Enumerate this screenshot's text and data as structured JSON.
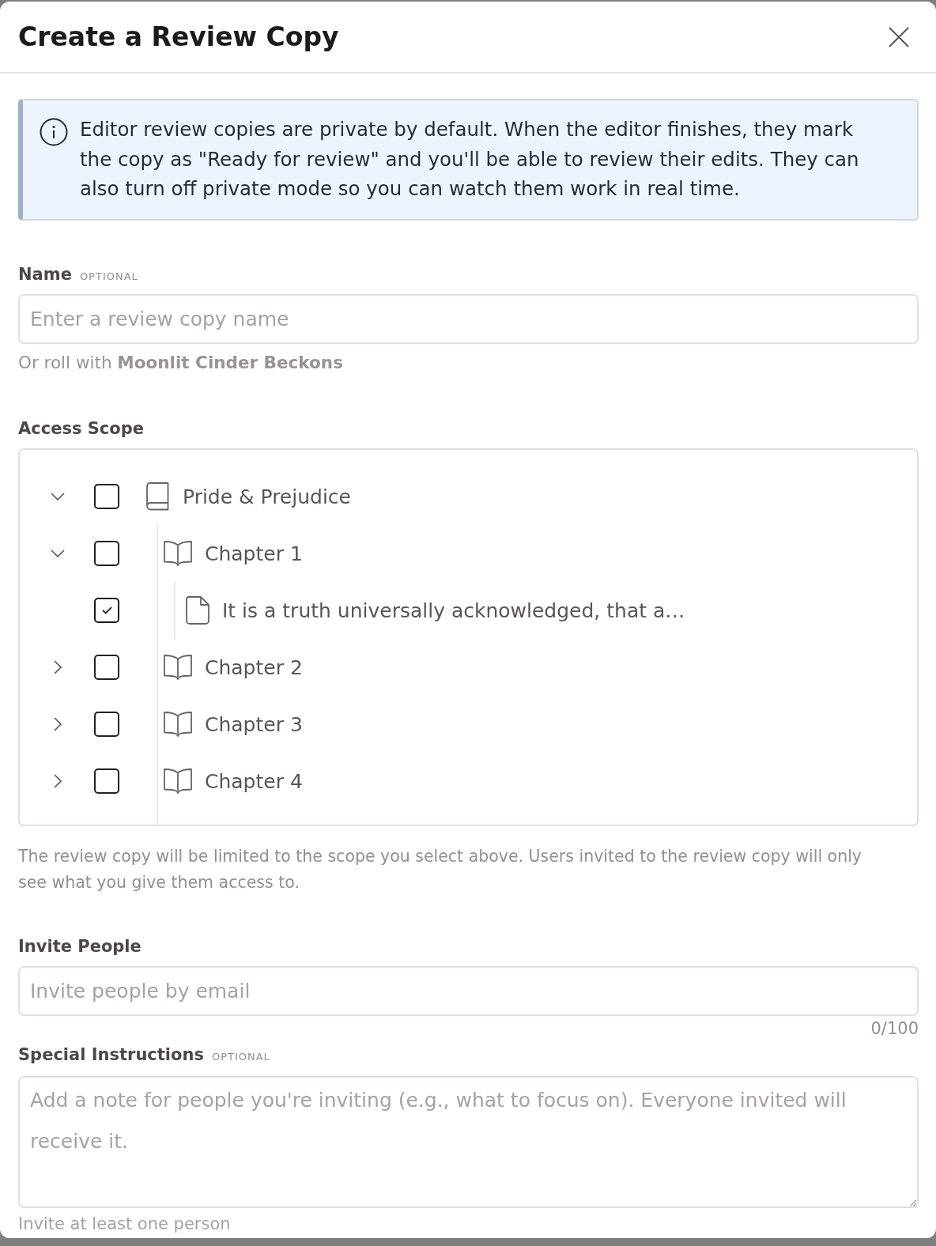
{
  "dialog": {
    "title": "Create a Review Copy"
  },
  "info_banner": {
    "text": "Editor review copies are private by default. When the editor finishes, they mark the copy as \"Ready for review\" and you'll be able to review their edits. They can also turn off private mode so you can watch them work in real time."
  },
  "name_field": {
    "label": "Name",
    "tag": "OPTIONAL",
    "placeholder": "Enter a review copy name",
    "suggestion": "Or roll with **Moonlit Cinder Beckons**"
  },
  "access_scope": {
    "label": "Access Scope",
    "tree": [
      {
        "kind": "book",
        "label": "Pride & Prejudice",
        "expanded": true,
        "checked": false,
        "children": [
          {
            "kind": "chapter",
            "label": "Chapter 1",
            "expanded": true,
            "checked": false,
            "children": [
              {
                "kind": "page",
                "label": "It is a truth universally acknowledged, that a…",
                "checked": true
              }
            ]
          },
          {
            "kind": "chapter",
            "label": "Chapter 2",
            "expanded": false,
            "checked": false
          },
          {
            "kind": "chapter",
            "label": "Chapter 3",
            "expanded": false,
            "checked": false
          },
          {
            "kind": "chapter",
            "label": "Chapter 4",
            "expanded": false,
            "checked": false
          }
        ]
      }
    ],
    "hint": "The review copy will be limited to the scope you select above. Users invited to the review copy will only see what you give them access to."
  },
  "invite_field": {
    "label": "Invite People",
    "placeholder": "Invite people by email",
    "counter": "0/100"
  },
  "instructions_field": {
    "label": "Special Instructions",
    "tag": "OPTIONAL",
    "placeholder": "Add a note for people you're inviting (e.g., what to focus on). Everyone invited will receive it.",
    "hint": "Invite at least one person"
  }
}
